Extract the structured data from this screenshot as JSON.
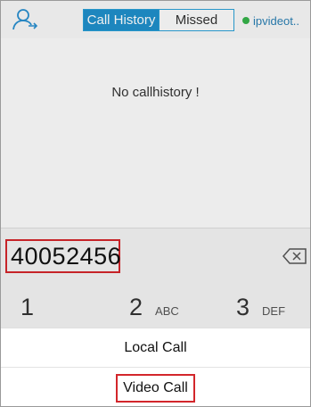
{
  "header": {
    "tabs": [
      {
        "label": "Call History",
        "active": true
      },
      {
        "label": "Missed",
        "active": false
      }
    ],
    "account": {
      "label": "ipvideot..",
      "status_color": "#36b24a"
    },
    "contacts_icon": "contacts-icon"
  },
  "history": {
    "empty_message": "No callhistory !"
  },
  "dialer": {
    "number": "40052456",
    "backspace_icon": "backspace-icon",
    "keys": [
      {
        "digit": "1",
        "letters": ""
      },
      {
        "digit": "2",
        "letters": "ABC"
      },
      {
        "digit": "3",
        "letters": "DEF"
      }
    ]
  },
  "action_sheet": {
    "items": [
      {
        "label": "Local Call"
      },
      {
        "label": "Video Call"
      }
    ]
  },
  "colors": {
    "accent": "#1f8fca",
    "highlight_box": "#d3262b"
  }
}
